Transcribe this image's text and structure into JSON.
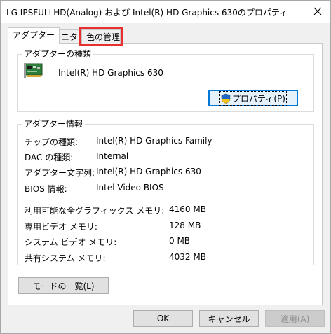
{
  "window": {
    "title": "LG IPSFULLHD(Analog) および Intel(R) HD Graphics 630のプロパティ"
  },
  "tabs": [
    {
      "label": "アダプター"
    },
    {
      "label": "モニター"
    },
    {
      "label": "色の管理"
    }
  ],
  "adapter_type": {
    "group_title": "アダプターの種類",
    "adapter_name": "Intel(R) HD Graphics 630",
    "properties_button": "プロパティ(P)"
  },
  "adapter_info": {
    "group_title": "アダプター情報",
    "rows": [
      {
        "label": "チップの種類:",
        "value": "Intel(R) HD Graphics Family"
      },
      {
        "label": "DAC の種類:",
        "value": "Internal"
      },
      {
        "label": "アダプター文字列:",
        "value": "Intel(R) HD Graphics 630"
      },
      {
        "label": "BIOS 情報:",
        "value": "Intel Video BIOS"
      }
    ],
    "memory_rows": [
      {
        "label": "利用可能な全グラフィックス メモリ:",
        "value": "4160 MB"
      },
      {
        "label": "専用ビデオ メモリ:",
        "value": "128 MB"
      },
      {
        "label": "システム ビデオ メモリ:",
        "value": "0 MB"
      },
      {
        "label": "共有システム メモリ:",
        "value": "4032 MB"
      }
    ]
  },
  "list_modes_button": "モードの一覧(L)",
  "footer": {
    "ok": "OK",
    "cancel": "キャンセル",
    "apply": "適用(A)"
  }
}
